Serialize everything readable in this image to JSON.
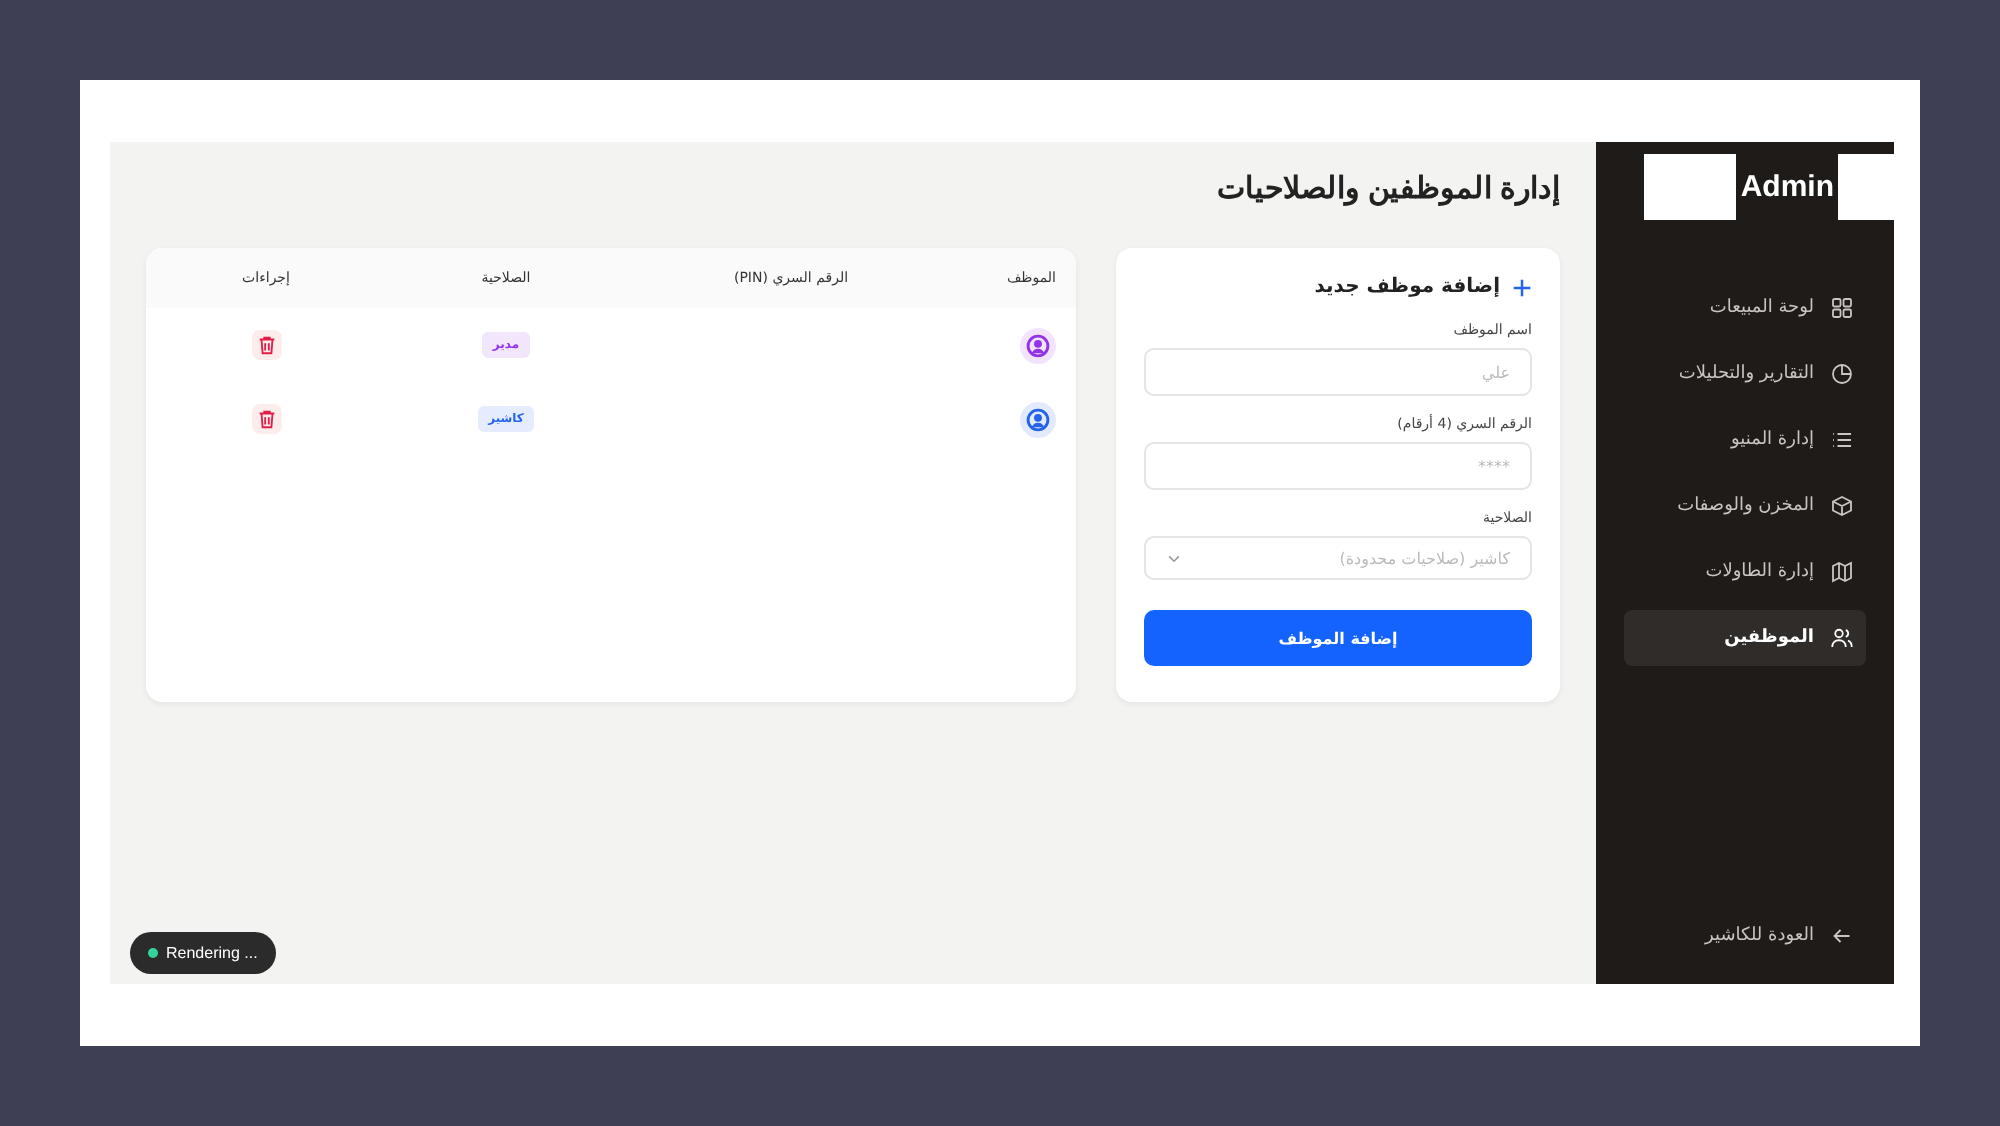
{
  "sidebar": {
    "brand": "Admin",
    "items": [
      {
        "label": "لوحة المبيعات",
        "selected": false
      },
      {
        "label": "التقارير والتحليلات",
        "selected": false
      },
      {
        "label": "إدارة المنيو",
        "selected": false
      },
      {
        "label": "المخزن والوصفات",
        "selected": false
      },
      {
        "label": "إدارة الطاولات",
        "selected": false
      },
      {
        "label": "الموظفين",
        "selected": true
      }
    ],
    "footer": "العودة للكاشير"
  },
  "page_title": "إدارة الموظفين والصلاحيات",
  "form": {
    "title": "إضافة موظف جديد",
    "fields": [
      {
        "label": "اسم الموظف",
        "placeholder": "علي",
        "kind": "text"
      },
      {
        "label": "الرقم السري (4 أرقام)",
        "placeholder": "****",
        "kind": "text"
      },
      {
        "label": "الصلاحية",
        "placeholder": "كاشير (صلاحيات محدودة)",
        "kind": "select"
      }
    ],
    "submit": "إضافة الموظف"
  },
  "table": {
    "columns": [
      "الموظف",
      "الرقم السري (PIN)",
      "الصلاحية",
      "إجراءات"
    ],
    "rows": [
      {
        "role": "مدير",
        "color": "#9333ea"
      },
      {
        "role": "كاشير",
        "color": "#2563eb"
      }
    ]
  },
  "status_badge": "Rendering ..."
}
